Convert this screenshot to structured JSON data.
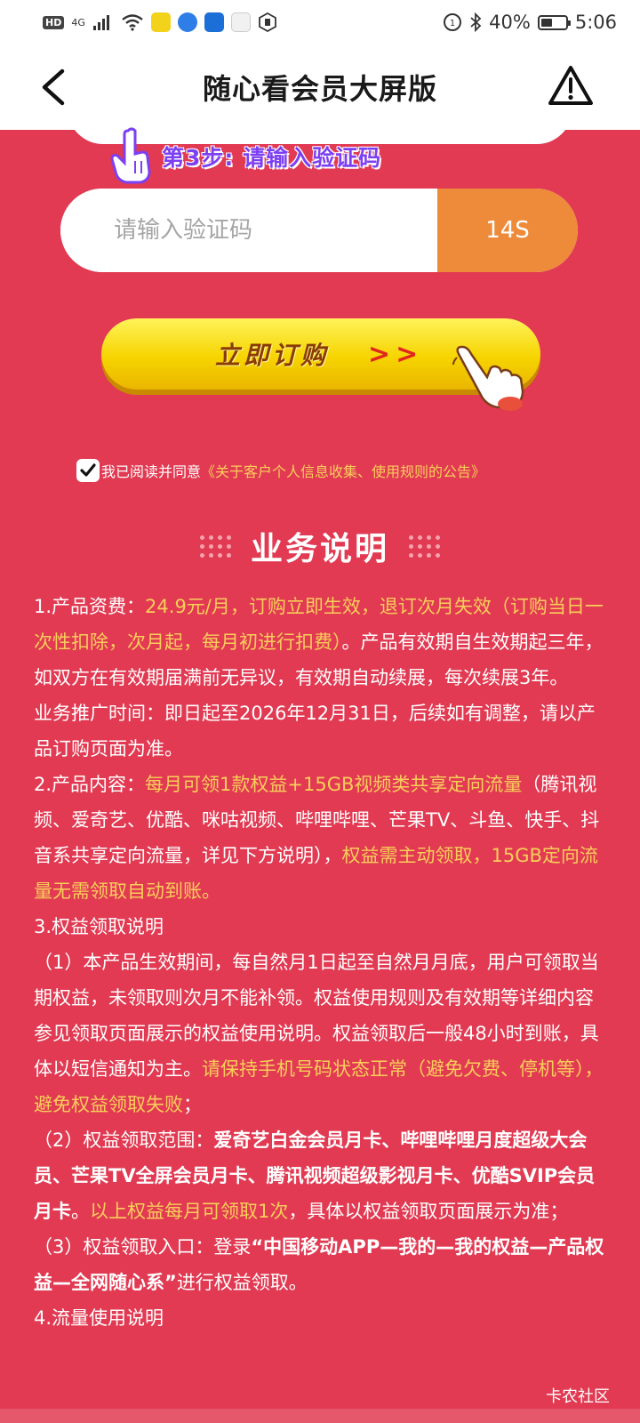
{
  "status_bar": {
    "hd": "HD",
    "network": "4G",
    "battery": "40%",
    "time": "5:06"
  },
  "nav": {
    "title": "随心看会员大屏版"
  },
  "step": {
    "text": "第3步: 请输入验证码"
  },
  "code_input": {
    "placeholder": "请输入验证码",
    "timer": "14S"
  },
  "subscribe": {
    "label": "立即订购",
    "arrows": ">>"
  },
  "agreement": {
    "text": "我已阅读并同意",
    "link": "《关于客户个人信息收集、使用规则的公告》"
  },
  "section": {
    "title": "业务说明"
  },
  "desc": {
    "p1a": "1.产品资费：",
    "p1b": "24.9元/月，订购立即生效，退订次月失效（订购当日一次性扣除，次月起，每月初进行扣费）",
    "p1c": "。产品有效期自生效期起三年，如双方在有效期届满前无异议，有效期自动续展，每次续展3年。",
    "p2": "业务推广时间：即日起至2026年12月31日，后续如有调整，请以产品订购页面为准。",
    "p3a": "2.产品内容：",
    "p3b": "每月可领1款权益+15GB视频类共享定向流量",
    "p3c": "（腾讯视频、爱奇艺、优酷、咪咕视频、哔哩哔哩、芒果TV、斗鱼、快手、抖音系共享定向流量，详见下方说明），",
    "p3d": "权益需主动领取，15GB定向流量无需领取自动到账。",
    "p4": "3.权益领取说明",
    "p5a": "（1）本产品生效期间，每自然月1日起至自然月月底，用户可领取当期权益，未领取则次月不能补领。权益使用规则及有效期等详细内容参见领取页面展示的权益使用说明。权益领取后一般48小时到账，具体以短信通知为主。",
    "p5b": "请保持手机号码状态正常（避免欠费、停机等），避免权益领取失败",
    "p5c": "；",
    "p6a": "（2）权益领取范围：",
    "p6b": "爱奇艺白金会员月卡、哔哩哔哩月度超级大会员、芒果TV全屏会员月卡、腾讯视频超级影视月卡、优酷SVIP会员月卡",
    "p6c": "。",
    "p6d": "以上权益每月可领取1次",
    "p6e": "，具体以权益领取页面展示为准；",
    "p7a": "（3）权益领取入口：登录",
    "p7b": "“中国移动APP—我的—我的权益—产品权益—全网随心系”",
    "p7c": "进行权益领取。",
    "p8": "4.流量使用说明"
  },
  "watermark": "卡农社区",
  "colors": {
    "background": "#e13a52",
    "highlight": "#f9ce5a",
    "timer": "#ee8b3a",
    "step_purple": "#7c3ff3",
    "button_yellow": "#f6d400"
  }
}
